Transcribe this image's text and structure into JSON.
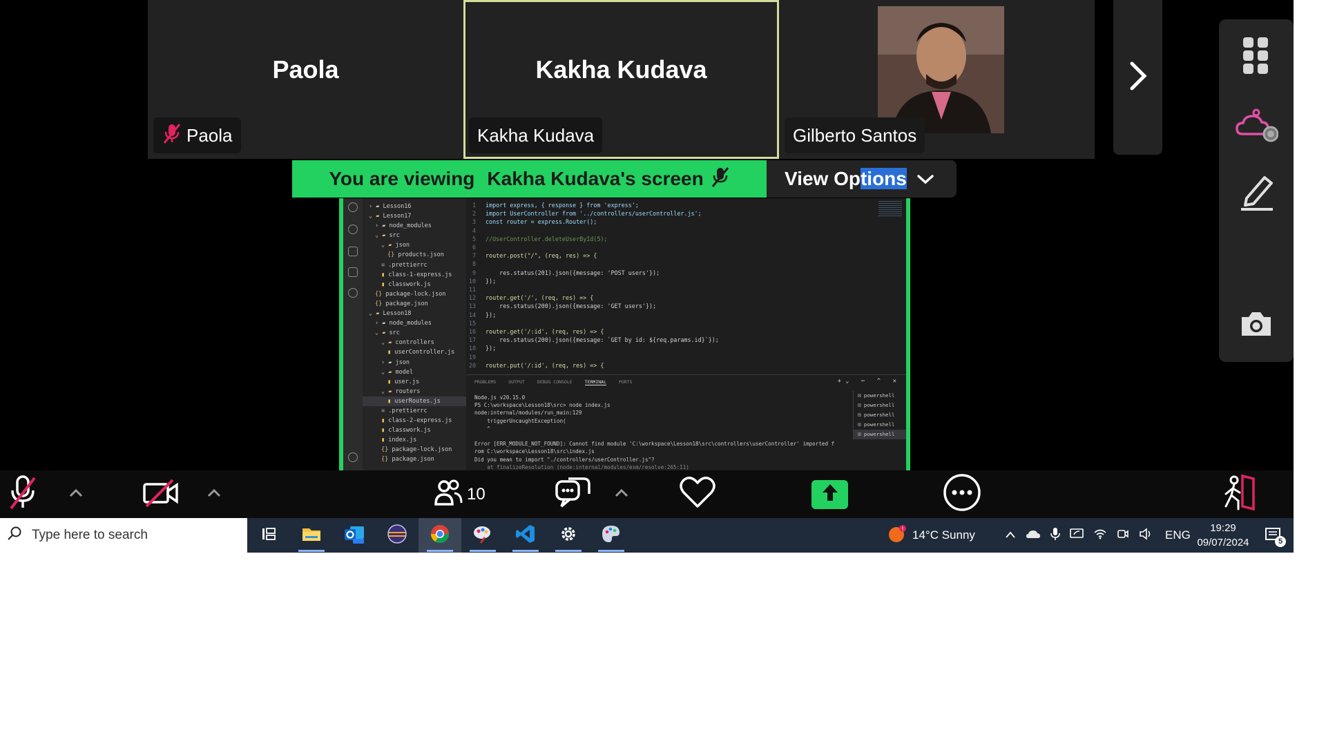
{
  "participants": [
    {
      "display": "Paola",
      "tag": "Paola",
      "muted": true
    },
    {
      "display": "Kakha Kudava",
      "tag": "Kakha Kudava",
      "speaking": true
    },
    {
      "display": "",
      "tag": "Gilberto Santos",
      "has_video": true
    }
  ],
  "banner": {
    "prefix": "You are viewing",
    "owner": "Kakha Kudava's screen",
    "view_options_a": "View Op",
    "view_options_b": "tions"
  },
  "explorer": {
    "rows": [
      {
        "indent": 1,
        "kind": "dir-closed",
        "label": "Lesson16"
      },
      {
        "indent": 1,
        "kind": "dir-open",
        "label": "Lesson17"
      },
      {
        "indent": 2,
        "kind": "dir-closed",
        "label": "node_modules"
      },
      {
        "indent": 2,
        "kind": "dir-open",
        "label": "src"
      },
      {
        "indent": 3,
        "kind": "dir-open",
        "label": "json"
      },
      {
        "indent": 4,
        "kind": "json",
        "label": "products.json"
      },
      {
        "indent": 3,
        "kind": "file",
        "label": ".prettierrc"
      },
      {
        "indent": 3,
        "kind": "js",
        "label": "class-1-express.js"
      },
      {
        "indent": 3,
        "kind": "js",
        "label": "classwork.js"
      },
      {
        "indent": 2,
        "kind": "json",
        "label": "package-lock.json"
      },
      {
        "indent": 2,
        "kind": "json",
        "label": "package.json"
      },
      {
        "indent": 1,
        "kind": "dir-open",
        "label": "Lesson18"
      },
      {
        "indent": 2,
        "kind": "dir-closed",
        "label": "node_modules"
      },
      {
        "indent": 2,
        "kind": "dir-open",
        "label": "src"
      },
      {
        "indent": 3,
        "kind": "dir-open",
        "label": "controllers"
      },
      {
        "indent": 4,
        "kind": "js",
        "label": "userController.js"
      },
      {
        "indent": 3,
        "kind": "dir-closed",
        "label": "json"
      },
      {
        "indent": 3,
        "kind": "dir-open",
        "label": "model"
      },
      {
        "indent": 4,
        "kind": "js",
        "label": "user.js"
      },
      {
        "indent": 3,
        "kind": "dir-open",
        "label": "routers"
      },
      {
        "indent": 4,
        "kind": "js",
        "label": "userRoutes.js",
        "selected": true
      },
      {
        "indent": 3,
        "kind": "file",
        "label": ".prettierrc"
      },
      {
        "indent": 3,
        "kind": "js",
        "label": "class-2-express.js"
      },
      {
        "indent": 3,
        "kind": "js",
        "label": "classwork.js"
      },
      {
        "indent": 3,
        "kind": "js",
        "label": "index.js"
      },
      {
        "indent": 3,
        "kind": "json",
        "label": "package-lock.json"
      },
      {
        "indent": 3,
        "kind": "json",
        "label": "package.json"
      }
    ]
  },
  "editor": {
    "lines": [
      {
        "n": "1",
        "text": "import express, { response } from 'express';"
      },
      {
        "n": "2",
        "text": "import UserController from '../controllers/userController.js';"
      },
      {
        "n": "3",
        "text": "const router = express.Router();"
      },
      {
        "n": "4",
        "text": ""
      },
      {
        "n": "5",
        "text": "//UserController.deleteUserById(5);"
      },
      {
        "n": "6",
        "text": ""
      },
      {
        "n": "7",
        "text": "router.post(\"/\", (req, res) => {"
      },
      {
        "n": "8",
        "text": ""
      },
      {
        "n": "9",
        "text": "    res.status(201).json({message: 'POST users'});"
      },
      {
        "n": "10",
        "text": "});"
      },
      {
        "n": "11",
        "text": ""
      },
      {
        "n": "12",
        "text": "router.get('/', (req, res) => {"
      },
      {
        "n": "13",
        "text": "    res.status(200).json({message: 'GET users'});"
      },
      {
        "n": "14",
        "text": "});"
      },
      {
        "n": "15",
        "text": ""
      },
      {
        "n": "16",
        "text": "router.get('/:id', (req, res) => {"
      },
      {
        "n": "17",
        "text": "    res.status(200).json({message: `GET by id: ${req.params.id}`});"
      },
      {
        "n": "18",
        "text": "});"
      },
      {
        "n": "19",
        "text": ""
      },
      {
        "n": "20",
        "text": "router.put('/:id', (req, res) => {"
      }
    ]
  },
  "panel": {
    "tabs": [
      "PROBLEMS",
      "OUTPUT",
      "DEBUG CONSOLE",
      "TERMINAL",
      "PORTS"
    ],
    "active_tab": "TERMINAL",
    "terminal": [
      "Node.js v20.15.0",
      "PS C:\\workspace\\Lesson18\\src> node index.js",
      "node:internal/modules/run_main:129",
      "    triggerUncaughtException(",
      "    ^",
      "",
      "Error [ERR_MODULE_NOT_FOUND]: Cannot find module 'C:\\workspace\\Lesson18\\src\\controllers\\userController' imported f",
      "rom C:\\workspace\\Lesson18\\src\\index.js",
      "Did you mean to import \"./controllers/userController.js\"?",
      "    at finalizeResolution (node:internal/modules/esm/resolve:265:11)"
    ],
    "terminals": [
      "powershell",
      "powershell",
      "powershell",
      "powershell",
      "powershell"
    ]
  },
  "controls": {
    "participants_count": "10"
  },
  "taskbar": {
    "search_placeholder": "Type here to search",
    "weather": "14°C  Sunny",
    "language": "ENG",
    "time": "19:29",
    "date": "09/07/2024",
    "notifications": "5"
  },
  "colors": {
    "accent_green": "#23d160",
    "speaking_border": "#d2df9b",
    "muted_red": "#e0245e"
  }
}
